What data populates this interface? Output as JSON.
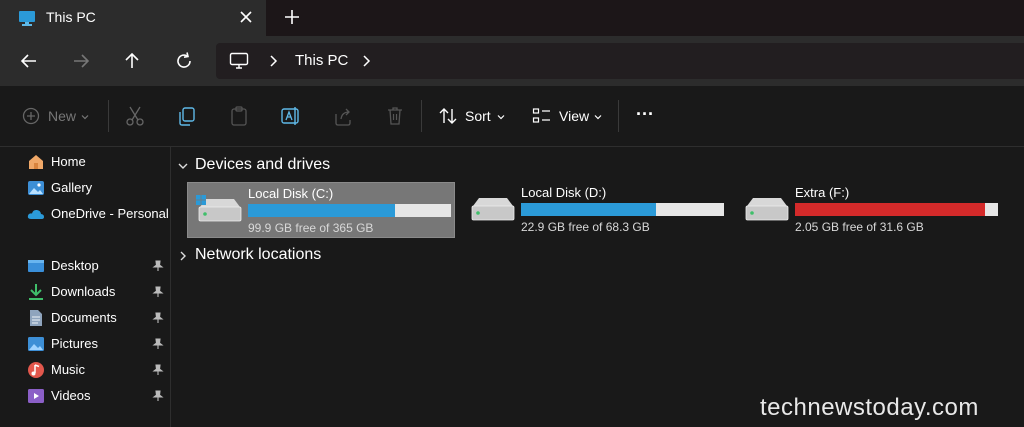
{
  "titlebar": {
    "tab_title": "This PC",
    "tab_icon": "monitor-icon",
    "new_tab_label": "+"
  },
  "navbar": {
    "back_icon": "arrow-left-icon",
    "forward_icon": "arrow-right-icon",
    "up_icon": "arrow-up-icon",
    "refresh_icon": "refresh-icon",
    "breadcrumb": [
      "This PC"
    ]
  },
  "commandbar": {
    "new_label": "New",
    "sort_label": "Sort",
    "view_label": "View",
    "more_label": "···",
    "icons": [
      "plus-circle-icon",
      "cut-icon",
      "copy-icon",
      "paste-icon",
      "rename-icon",
      "share-icon",
      "delete-icon",
      "sort-icon",
      "view-icon"
    ]
  },
  "sidebar": {
    "items": [
      {
        "label": "Home",
        "icon": "home-icon"
      },
      {
        "label": "Gallery",
        "icon": "gallery-icon"
      },
      {
        "label": "OneDrive - Personal",
        "icon": "onedrive-icon"
      },
      {
        "label": "Desktop",
        "icon": "desktop-folder-icon",
        "pinned": true
      },
      {
        "label": "Downloads",
        "icon": "downloads-icon",
        "pinned": true
      },
      {
        "label": "Documents",
        "icon": "documents-icon",
        "pinned": true
      },
      {
        "label": "Pictures",
        "icon": "pictures-icon",
        "pinned": true
      },
      {
        "label": "Music",
        "icon": "music-icon",
        "pinned": true
      },
      {
        "label": "Videos",
        "icon": "videos-icon",
        "pinned": true
      }
    ]
  },
  "main": {
    "sections": [
      {
        "label": "Devices and drives",
        "expanded": true
      },
      {
        "label": "Network locations",
        "expanded": false
      }
    ],
    "drives": [
      {
        "name": "Local Disk (C:)",
        "free": "99.9 GB free of 365 GB",
        "used_fraction": 0.726,
        "bar_color": "#2b9ad8",
        "selected": true
      },
      {
        "name": "Local Disk (D:)",
        "free": "22.9 GB free of 68.3 GB",
        "used_fraction": 0.665,
        "bar_color": "#2b9ad8",
        "selected": false
      },
      {
        "name": "Extra (F:)",
        "free": "2.05 GB free of 31.6 GB",
        "used_fraction": 0.935,
        "bar_color": "#d42a2a",
        "selected": false
      }
    ]
  },
  "watermark": "technewstoday.com",
  "colors": {
    "accent": "#2b9ad8",
    "warning": "#d42a2a",
    "background": "#191919"
  }
}
